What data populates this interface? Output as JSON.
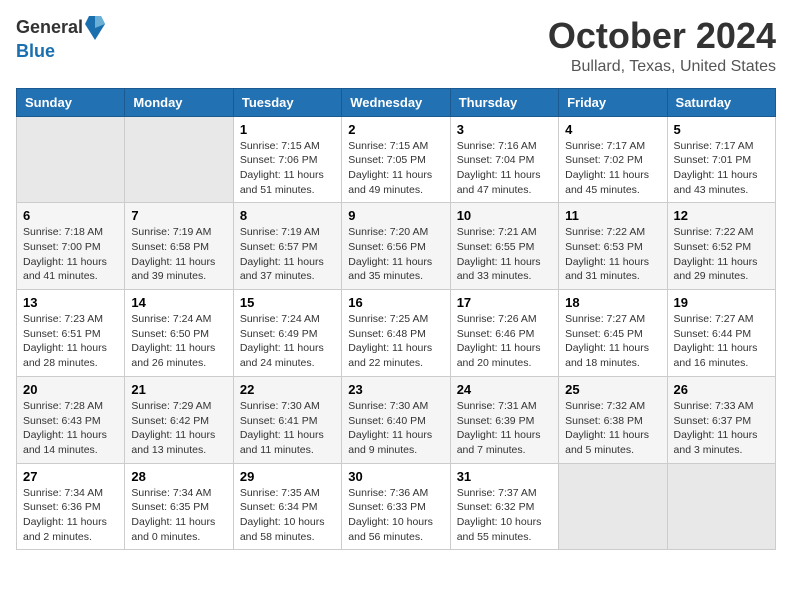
{
  "header": {
    "logo_general": "General",
    "logo_blue": "Blue",
    "title": "October 2024",
    "location": "Bullard, Texas, United States"
  },
  "weekdays": [
    "Sunday",
    "Monday",
    "Tuesday",
    "Wednesday",
    "Thursday",
    "Friday",
    "Saturday"
  ],
  "weeks": [
    [
      {
        "day": "",
        "sunrise": "",
        "sunset": "",
        "daylight": "",
        "empty": true
      },
      {
        "day": "",
        "sunrise": "",
        "sunset": "",
        "daylight": "",
        "empty": true
      },
      {
        "day": "1",
        "sunrise": "Sunrise: 7:15 AM",
        "sunset": "Sunset: 7:06 PM",
        "daylight": "Daylight: 11 hours and 51 minutes.",
        "empty": false
      },
      {
        "day": "2",
        "sunrise": "Sunrise: 7:15 AM",
        "sunset": "Sunset: 7:05 PM",
        "daylight": "Daylight: 11 hours and 49 minutes.",
        "empty": false
      },
      {
        "day": "3",
        "sunrise": "Sunrise: 7:16 AM",
        "sunset": "Sunset: 7:04 PM",
        "daylight": "Daylight: 11 hours and 47 minutes.",
        "empty": false
      },
      {
        "day": "4",
        "sunrise": "Sunrise: 7:17 AM",
        "sunset": "Sunset: 7:02 PM",
        "daylight": "Daylight: 11 hours and 45 minutes.",
        "empty": false
      },
      {
        "day": "5",
        "sunrise": "Sunrise: 7:17 AM",
        "sunset": "Sunset: 7:01 PM",
        "daylight": "Daylight: 11 hours and 43 minutes.",
        "empty": false
      }
    ],
    [
      {
        "day": "6",
        "sunrise": "Sunrise: 7:18 AM",
        "sunset": "Sunset: 7:00 PM",
        "daylight": "Daylight: 11 hours and 41 minutes.",
        "empty": false
      },
      {
        "day": "7",
        "sunrise": "Sunrise: 7:19 AM",
        "sunset": "Sunset: 6:58 PM",
        "daylight": "Daylight: 11 hours and 39 minutes.",
        "empty": false
      },
      {
        "day": "8",
        "sunrise": "Sunrise: 7:19 AM",
        "sunset": "Sunset: 6:57 PM",
        "daylight": "Daylight: 11 hours and 37 minutes.",
        "empty": false
      },
      {
        "day": "9",
        "sunrise": "Sunrise: 7:20 AM",
        "sunset": "Sunset: 6:56 PM",
        "daylight": "Daylight: 11 hours and 35 minutes.",
        "empty": false
      },
      {
        "day": "10",
        "sunrise": "Sunrise: 7:21 AM",
        "sunset": "Sunset: 6:55 PM",
        "daylight": "Daylight: 11 hours and 33 minutes.",
        "empty": false
      },
      {
        "day": "11",
        "sunrise": "Sunrise: 7:22 AM",
        "sunset": "Sunset: 6:53 PM",
        "daylight": "Daylight: 11 hours and 31 minutes.",
        "empty": false
      },
      {
        "day": "12",
        "sunrise": "Sunrise: 7:22 AM",
        "sunset": "Sunset: 6:52 PM",
        "daylight": "Daylight: 11 hours and 29 minutes.",
        "empty": false
      }
    ],
    [
      {
        "day": "13",
        "sunrise": "Sunrise: 7:23 AM",
        "sunset": "Sunset: 6:51 PM",
        "daylight": "Daylight: 11 hours and 28 minutes.",
        "empty": false
      },
      {
        "day": "14",
        "sunrise": "Sunrise: 7:24 AM",
        "sunset": "Sunset: 6:50 PM",
        "daylight": "Daylight: 11 hours and 26 minutes.",
        "empty": false
      },
      {
        "day": "15",
        "sunrise": "Sunrise: 7:24 AM",
        "sunset": "Sunset: 6:49 PM",
        "daylight": "Daylight: 11 hours and 24 minutes.",
        "empty": false
      },
      {
        "day": "16",
        "sunrise": "Sunrise: 7:25 AM",
        "sunset": "Sunset: 6:48 PM",
        "daylight": "Daylight: 11 hours and 22 minutes.",
        "empty": false
      },
      {
        "day": "17",
        "sunrise": "Sunrise: 7:26 AM",
        "sunset": "Sunset: 6:46 PM",
        "daylight": "Daylight: 11 hours and 20 minutes.",
        "empty": false
      },
      {
        "day": "18",
        "sunrise": "Sunrise: 7:27 AM",
        "sunset": "Sunset: 6:45 PM",
        "daylight": "Daylight: 11 hours and 18 minutes.",
        "empty": false
      },
      {
        "day": "19",
        "sunrise": "Sunrise: 7:27 AM",
        "sunset": "Sunset: 6:44 PM",
        "daylight": "Daylight: 11 hours and 16 minutes.",
        "empty": false
      }
    ],
    [
      {
        "day": "20",
        "sunrise": "Sunrise: 7:28 AM",
        "sunset": "Sunset: 6:43 PM",
        "daylight": "Daylight: 11 hours and 14 minutes.",
        "empty": false
      },
      {
        "day": "21",
        "sunrise": "Sunrise: 7:29 AM",
        "sunset": "Sunset: 6:42 PM",
        "daylight": "Daylight: 11 hours and 13 minutes.",
        "empty": false
      },
      {
        "day": "22",
        "sunrise": "Sunrise: 7:30 AM",
        "sunset": "Sunset: 6:41 PM",
        "daylight": "Daylight: 11 hours and 11 minutes.",
        "empty": false
      },
      {
        "day": "23",
        "sunrise": "Sunrise: 7:30 AM",
        "sunset": "Sunset: 6:40 PM",
        "daylight": "Daylight: 11 hours and 9 minutes.",
        "empty": false
      },
      {
        "day": "24",
        "sunrise": "Sunrise: 7:31 AM",
        "sunset": "Sunset: 6:39 PM",
        "daylight": "Daylight: 11 hours and 7 minutes.",
        "empty": false
      },
      {
        "day": "25",
        "sunrise": "Sunrise: 7:32 AM",
        "sunset": "Sunset: 6:38 PM",
        "daylight": "Daylight: 11 hours and 5 minutes.",
        "empty": false
      },
      {
        "day": "26",
        "sunrise": "Sunrise: 7:33 AM",
        "sunset": "Sunset: 6:37 PM",
        "daylight": "Daylight: 11 hours and 3 minutes.",
        "empty": false
      }
    ],
    [
      {
        "day": "27",
        "sunrise": "Sunrise: 7:34 AM",
        "sunset": "Sunset: 6:36 PM",
        "daylight": "Daylight: 11 hours and 2 minutes.",
        "empty": false
      },
      {
        "day": "28",
        "sunrise": "Sunrise: 7:34 AM",
        "sunset": "Sunset: 6:35 PM",
        "daylight": "Daylight: 11 hours and 0 minutes.",
        "empty": false
      },
      {
        "day": "29",
        "sunrise": "Sunrise: 7:35 AM",
        "sunset": "Sunset: 6:34 PM",
        "daylight": "Daylight: 10 hours and 58 minutes.",
        "empty": false
      },
      {
        "day": "30",
        "sunrise": "Sunrise: 7:36 AM",
        "sunset": "Sunset: 6:33 PM",
        "daylight": "Daylight: 10 hours and 56 minutes.",
        "empty": false
      },
      {
        "day": "31",
        "sunrise": "Sunrise: 7:37 AM",
        "sunset": "Sunset: 6:32 PM",
        "daylight": "Daylight: 10 hours and 55 minutes.",
        "empty": false
      },
      {
        "day": "",
        "sunrise": "",
        "sunset": "",
        "daylight": "",
        "empty": true
      },
      {
        "day": "",
        "sunrise": "",
        "sunset": "",
        "daylight": "",
        "empty": true
      }
    ]
  ]
}
